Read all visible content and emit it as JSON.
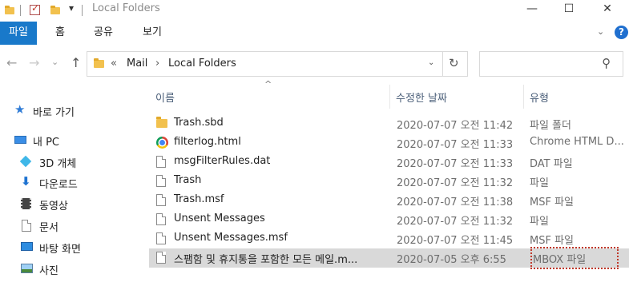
{
  "window": {
    "title": "Local Folders",
    "controls": {
      "minimize": "—",
      "maximize": "☐",
      "close": "✕"
    }
  },
  "ribbon": {
    "tabs": [
      "파일",
      "홈",
      "공유",
      "보기"
    ],
    "expand_glyph": "⌄",
    "help": "?"
  },
  "navbar": {
    "back": "←",
    "forward": "→",
    "recent": "⌄",
    "up": "↑",
    "breadcrumb": [
      "Mail",
      "Local Folders"
    ],
    "overflow": "«",
    "separator": "›",
    "refresh": "↻",
    "search_placeholder": ""
  },
  "nav_pane": {
    "items": [
      {
        "label": "바로 가기",
        "icon": "star-icon"
      },
      {
        "label": "내 PC",
        "icon": "computer-icon"
      },
      {
        "label": "3D 개체",
        "icon": "cube-icon"
      },
      {
        "label": "다운로드",
        "icon": "download-icon"
      },
      {
        "label": "동영상",
        "icon": "film-icon"
      },
      {
        "label": "문서",
        "icon": "document-icon"
      },
      {
        "label": "바탕 화면",
        "icon": "desktop-icon"
      },
      {
        "label": "사진",
        "icon": "picture-icon"
      }
    ]
  },
  "columns": {
    "name": "이름",
    "date": "수정한 날짜",
    "type": "유형"
  },
  "files": [
    {
      "name": "Trash.sbd",
      "date": "2020-07-07 오전 11:42",
      "type": "파일 폴더",
      "icon": "folder-icon"
    },
    {
      "name": "filterlog.html",
      "date": "2020-07-07 오전 11:33",
      "type": "Chrome HTML D...",
      "icon": "chrome-icon"
    },
    {
      "name": "msgFilterRules.dat",
      "date": "2020-07-07 오전 11:33",
      "type": "DAT 파일",
      "icon": "file-icon"
    },
    {
      "name": "Trash",
      "date": "2020-07-07 오전 11:32",
      "type": "파일",
      "icon": "file-icon"
    },
    {
      "name": "Trash.msf",
      "date": "2020-07-07 오전 11:38",
      "type": "MSF 파일",
      "icon": "file-icon"
    },
    {
      "name": "Unsent Messages",
      "date": "2020-07-07 오전 11:32",
      "type": "파일",
      "icon": "file-icon"
    },
    {
      "name": "Unsent Messages.msf",
      "date": "2020-07-07 오전 11:45",
      "type": "MSF 파일",
      "icon": "file-icon"
    },
    {
      "name": "스팸함 및 휴지통을 포함한 모든 메일.m...",
      "date": "2020-07-05 오후 6:55",
      "type": "MBOX 파일",
      "icon": "file-icon",
      "selected": true
    }
  ],
  "colors": {
    "accent": "#1979ca",
    "selection": "#d9d9d9",
    "highlight": "#c0392b"
  }
}
